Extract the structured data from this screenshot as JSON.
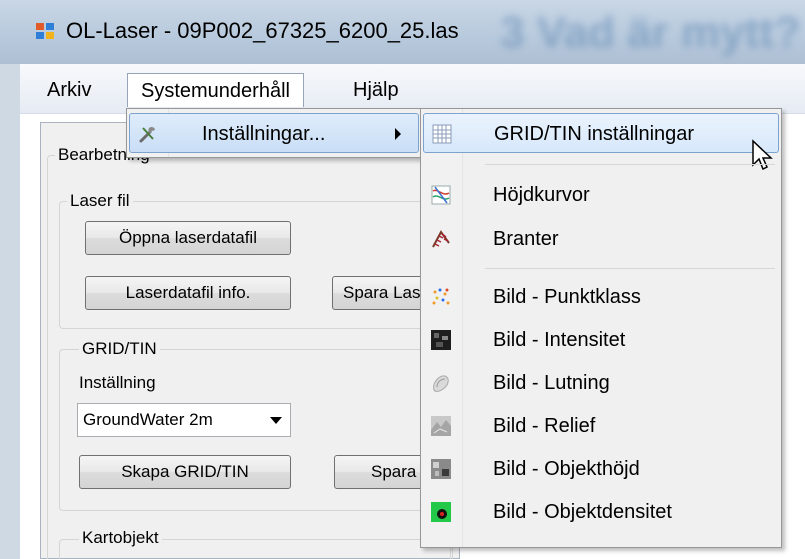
{
  "window": {
    "title": "OL-Laser - 09P002_67325_6200_25.las",
    "background_caption": "3 Vad är mytt?"
  },
  "menubar": {
    "items": [
      {
        "label": "Arkiv"
      },
      {
        "label": "Systemunderhåll"
      },
      {
        "label": "Hjälp"
      }
    ]
  },
  "panel": {
    "group_title": "Bearbetning",
    "laser_group": {
      "title": "Laser fil",
      "open_button": "Öppna laserdatafil",
      "info_button": "Laserdatafil info.",
      "save_button": "Spara Las"
    },
    "grid_group": {
      "title": "GRID/TIN",
      "setting_label": "Inställning",
      "setting_value": "GroundWater 2m",
      "create_button": "Skapa GRID/TIN",
      "save_button": "Spara G"
    },
    "map_group": {
      "title": "Kartobjekt"
    }
  },
  "systemmenu": {
    "items": [
      {
        "label": "Inställningar...",
        "icon": "tools-icon",
        "has_submenu": true
      }
    ]
  },
  "submenu": {
    "items": [
      {
        "label": "GRID/TIN inställningar",
        "icon": "grid-icon",
        "highlighted": true
      },
      {
        "label": "Höjdkurvor",
        "icon": "contour-icon"
      },
      {
        "label": "Branter",
        "icon": "cliff-icon"
      },
      {
        "label": "Bild - Punktklass",
        "icon": "point-class-icon"
      },
      {
        "label": "Bild - Intensitet",
        "icon": "intensity-icon"
      },
      {
        "label": "Bild - Lutning",
        "icon": "slope-icon"
      },
      {
        "label": "Bild - Relief",
        "icon": "relief-icon"
      },
      {
        "label": "Bild - Objekthöjd",
        "icon": "object-height-icon"
      },
      {
        "label": "Bild - Objektdensitet",
        "icon": "object-density-icon"
      }
    ]
  }
}
